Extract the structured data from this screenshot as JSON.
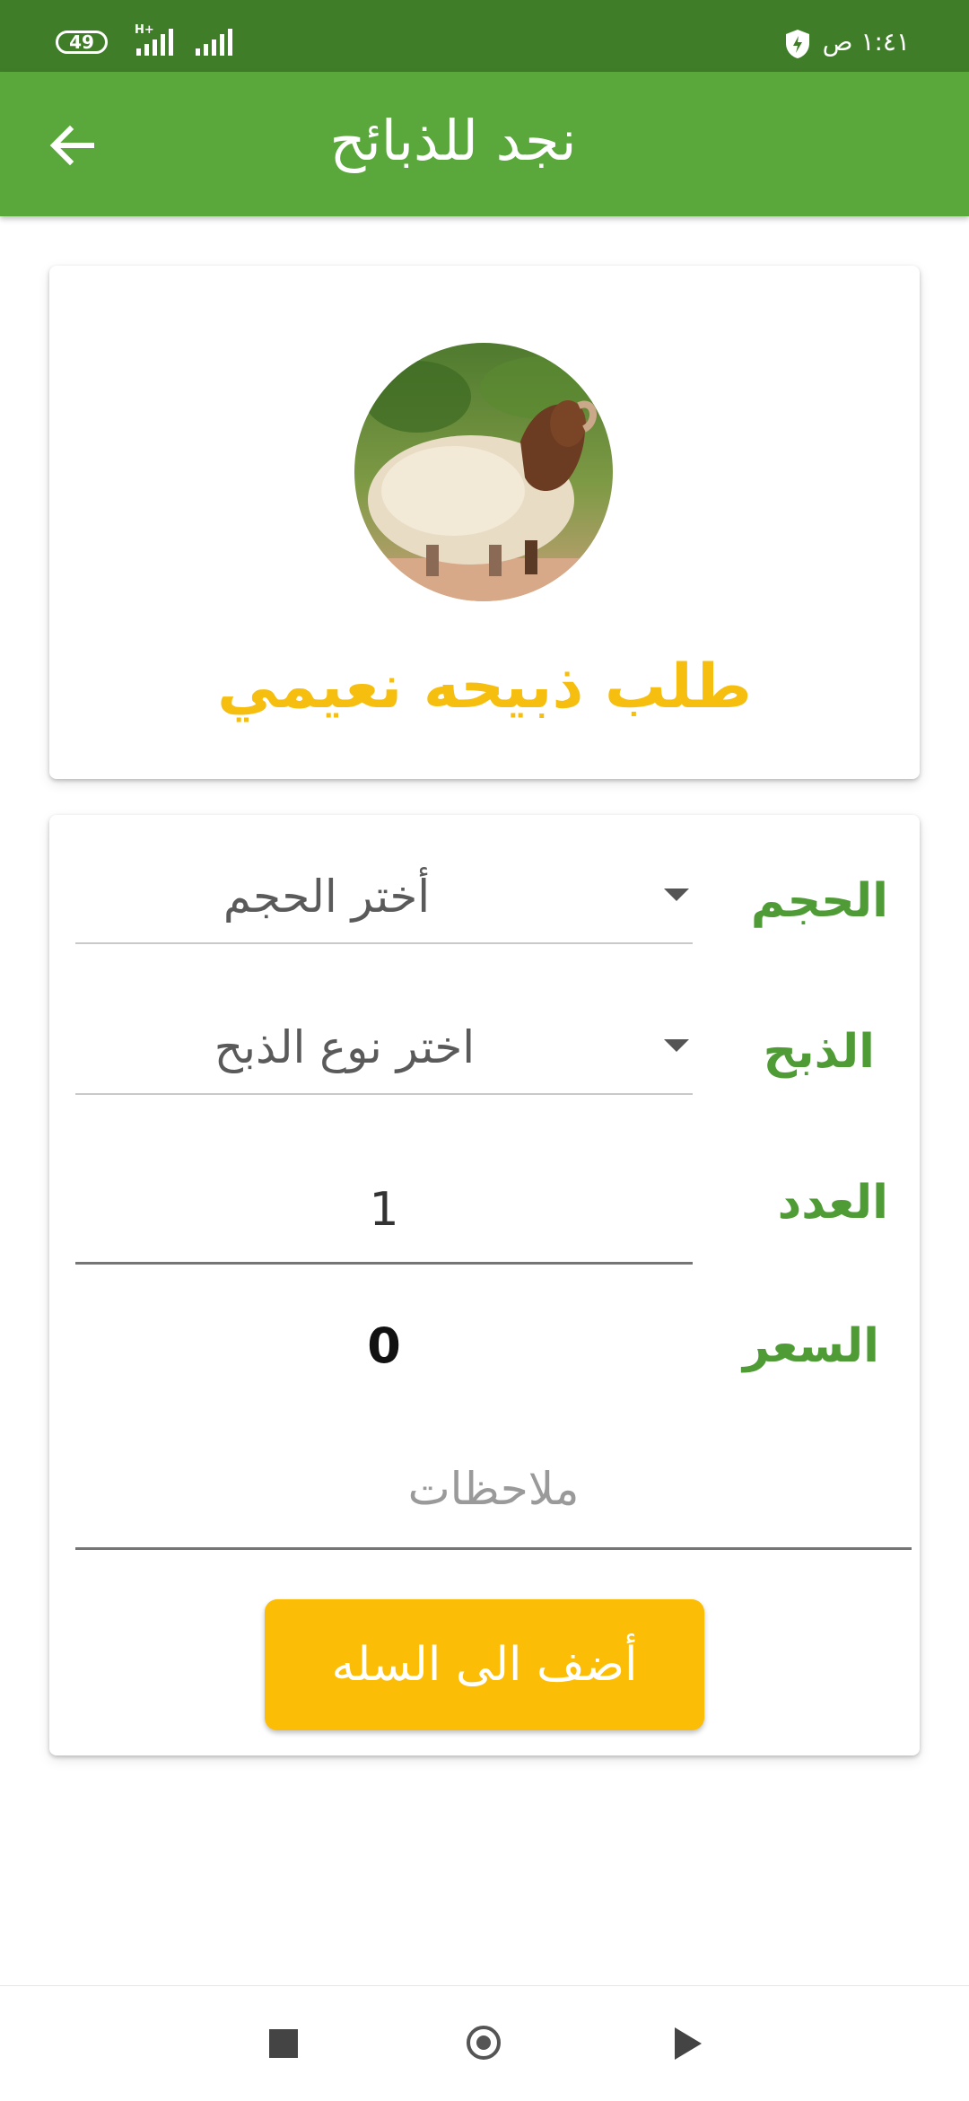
{
  "status_bar": {
    "battery": "49",
    "network_type": "H+",
    "time": "١:٤١ ص"
  },
  "app_bar": {
    "title": "نجد للذبائح",
    "back_icon": "arrow-left-icon"
  },
  "product": {
    "title": "طلب ذبيحه نعيمي",
    "image": "sheep-photo"
  },
  "form": {
    "size": {
      "label": "الحجم",
      "value": "أختر الحجم"
    },
    "slaughter": {
      "label": "الذبح",
      "value": "اختر نوع الذبح"
    },
    "count": {
      "label": "العدد",
      "value": "1"
    },
    "price": {
      "label": "السعر",
      "value": "0"
    },
    "notes": {
      "placeholder": "ملاحظات"
    },
    "add_button": "أضف الى السله"
  },
  "colors": {
    "status_bar": "#3f7d28",
    "app_bar": "#5aa83b",
    "accent_yellow": "#fbbd06",
    "label_green": "#4f9c36"
  },
  "nav_bar": {
    "icons": [
      "recents-square-icon",
      "home-circle-icon",
      "back-triangle-icon"
    ]
  }
}
